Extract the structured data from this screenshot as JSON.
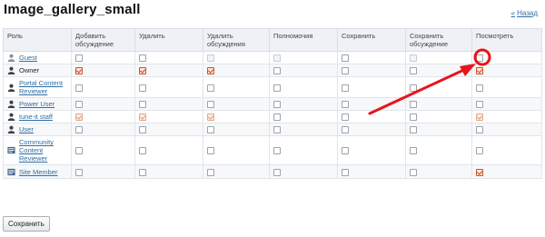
{
  "page": {
    "title": "Image_gallery_small",
    "back_label": "Назад",
    "back_arrow": "«"
  },
  "table": {
    "headers": [
      "Роль",
      "Добавить обсуждение",
      "Удалить",
      "Удалить обсуждения",
      "Полномочия",
      "Сохранить",
      "Сохранить обсуждение",
      "Посмотреть"
    ],
    "rows": [
      {
        "role": "Guest",
        "icon": "user-icon-gray",
        "link": true,
        "cells": [
          "unchecked",
          "unchecked",
          "disabled",
          "disabled",
          "unchecked",
          "disabled",
          "unchecked"
        ]
      },
      {
        "role": "Owner",
        "icon": "user-icon-dark",
        "link": false,
        "cells": [
          "checked",
          "checked",
          "checked",
          "unchecked",
          "unchecked",
          "unchecked",
          "checked"
        ]
      },
      {
        "role": "Portal Content Reviewer",
        "icon": "user-icon-dark",
        "link": true,
        "cells": [
          "unchecked",
          "unchecked",
          "unchecked",
          "unchecked",
          "unchecked",
          "unchecked",
          "unchecked"
        ]
      },
      {
        "role": "Power User",
        "icon": "user-icon-dark",
        "link": true,
        "cells": [
          "unchecked",
          "unchecked",
          "unchecked",
          "unchecked",
          "unchecked",
          "unchecked",
          "unchecked"
        ]
      },
      {
        "role": "tune-it staff",
        "icon": "user-icon-dark",
        "link": true,
        "cells": [
          "checked-disabled",
          "checked-disabled",
          "checked-disabled",
          "unchecked",
          "unchecked",
          "unchecked",
          "checked-disabled"
        ]
      },
      {
        "role": "User",
        "icon": "user-icon-dark",
        "link": true,
        "cells": [
          "unchecked",
          "unchecked",
          "unchecked",
          "unchecked",
          "unchecked",
          "unchecked",
          "unchecked"
        ]
      },
      {
        "role": "Community Content Reviewer",
        "icon": "group-card-icon",
        "link": true,
        "cells": [
          "unchecked",
          "unchecked",
          "unchecked",
          "unchecked",
          "unchecked",
          "unchecked",
          "unchecked"
        ]
      },
      {
        "role": "Site Member",
        "icon": "group-card-icon",
        "link": true,
        "cells": [
          "unchecked",
          "unchecked",
          "unchecked",
          "unchecked",
          "unchecked",
          "unchecked",
          "checked"
        ]
      }
    ]
  },
  "actions": {
    "save_label": "Сохранить"
  },
  "colors": {
    "annotation": "#e8141b",
    "link": "#2e6da4",
    "header_bg": "#eef1f5"
  }
}
